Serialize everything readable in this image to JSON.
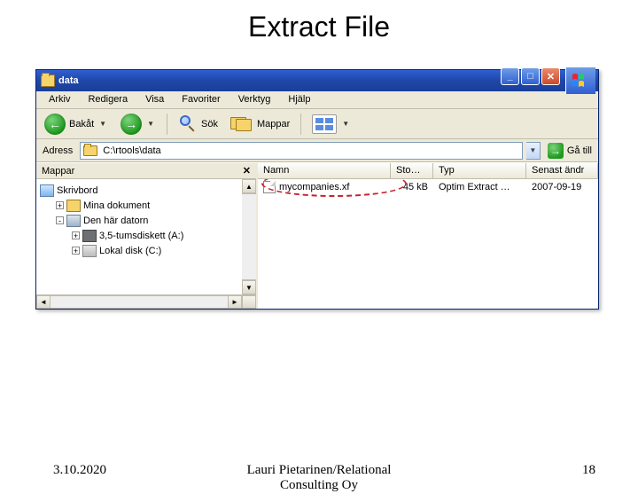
{
  "slide": {
    "title": "Extract File",
    "date": "3.10.2020",
    "author_line1": "Lauri Pietarinen/Relational",
    "author_line2": "Consulting Oy",
    "page": "18"
  },
  "titlebar": {
    "caption": "data"
  },
  "menu": {
    "items": [
      "Arkiv",
      "Redigera",
      "Visa",
      "Favoriter",
      "Verktyg",
      "Hjälp"
    ]
  },
  "toolbar": {
    "back_label": "Bakåt",
    "search_label": "Sök",
    "folders_label": "Mappar"
  },
  "addressbar": {
    "label": "Adress",
    "path": "C:\\rtools\\data",
    "go_label": "Gå till"
  },
  "leftpane": {
    "header": "Mappar",
    "rows": [
      {
        "expander": "",
        "icon": "idesk",
        "label": "Skrivbord"
      },
      {
        "expander": "+",
        "icon": "idoc",
        "label": "Mina dokument"
      },
      {
        "expander": "-",
        "icon": "ipc",
        "label": "Den här datorn"
      },
      {
        "expander": "+",
        "icon": "ifloppy",
        "label": "3,5-tumsdiskett (A:)"
      },
      {
        "expander": "+",
        "icon": "idisk",
        "label": "Lokal disk (C:)"
      }
    ]
  },
  "list": {
    "columns": {
      "name": "Namn",
      "size": "Sto…",
      "type": "Typ",
      "date": "Senast ändr"
    },
    "rows": [
      {
        "name": "mycompanies.xf",
        "size": "45 kB",
        "type": "Optim Extract …",
        "date": "2007-09-19"
      }
    ]
  }
}
